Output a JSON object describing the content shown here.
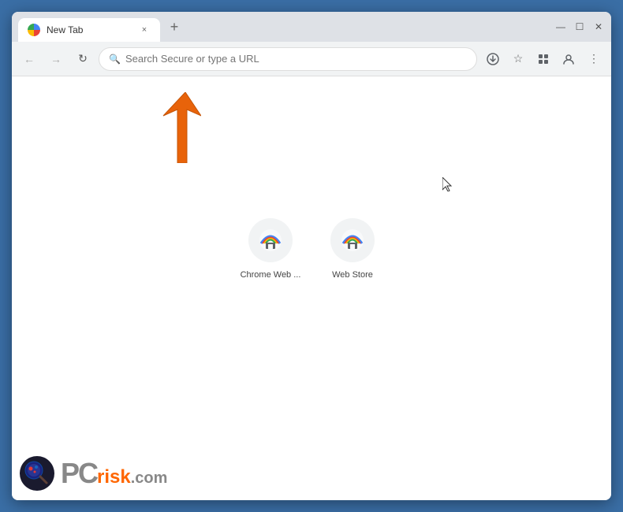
{
  "browser": {
    "tab": {
      "title": "New Tab",
      "close_label": "×"
    },
    "new_tab_button": "+",
    "window_controls": {
      "minimize": "—",
      "maximize": "☐",
      "close": "✕"
    },
    "toolbar": {
      "back_label": "←",
      "forward_label": "→",
      "reload_label": "↻",
      "address_placeholder": "Search Secure or type a URL",
      "bookmark_icon": "☆",
      "extensions_icon": "🧩",
      "profile_icon": "👤",
      "menu_icon": "⋮"
    }
  },
  "new_tab": {
    "shortcuts": [
      {
        "label": "Chrome Web ...",
        "icon_type": "chrome-webstore"
      },
      {
        "label": "Web Store",
        "icon_type": "chrome-webstore"
      }
    ]
  },
  "watermark": {
    "pc_text": "PC",
    "risk_text": "risk",
    "com_text": ".com"
  },
  "colors": {
    "accent_orange": "#ff6600",
    "tab_bg": "#ffffff",
    "toolbar_bg": "#f1f3f4",
    "titlebar_bg": "#dee1e6"
  }
}
